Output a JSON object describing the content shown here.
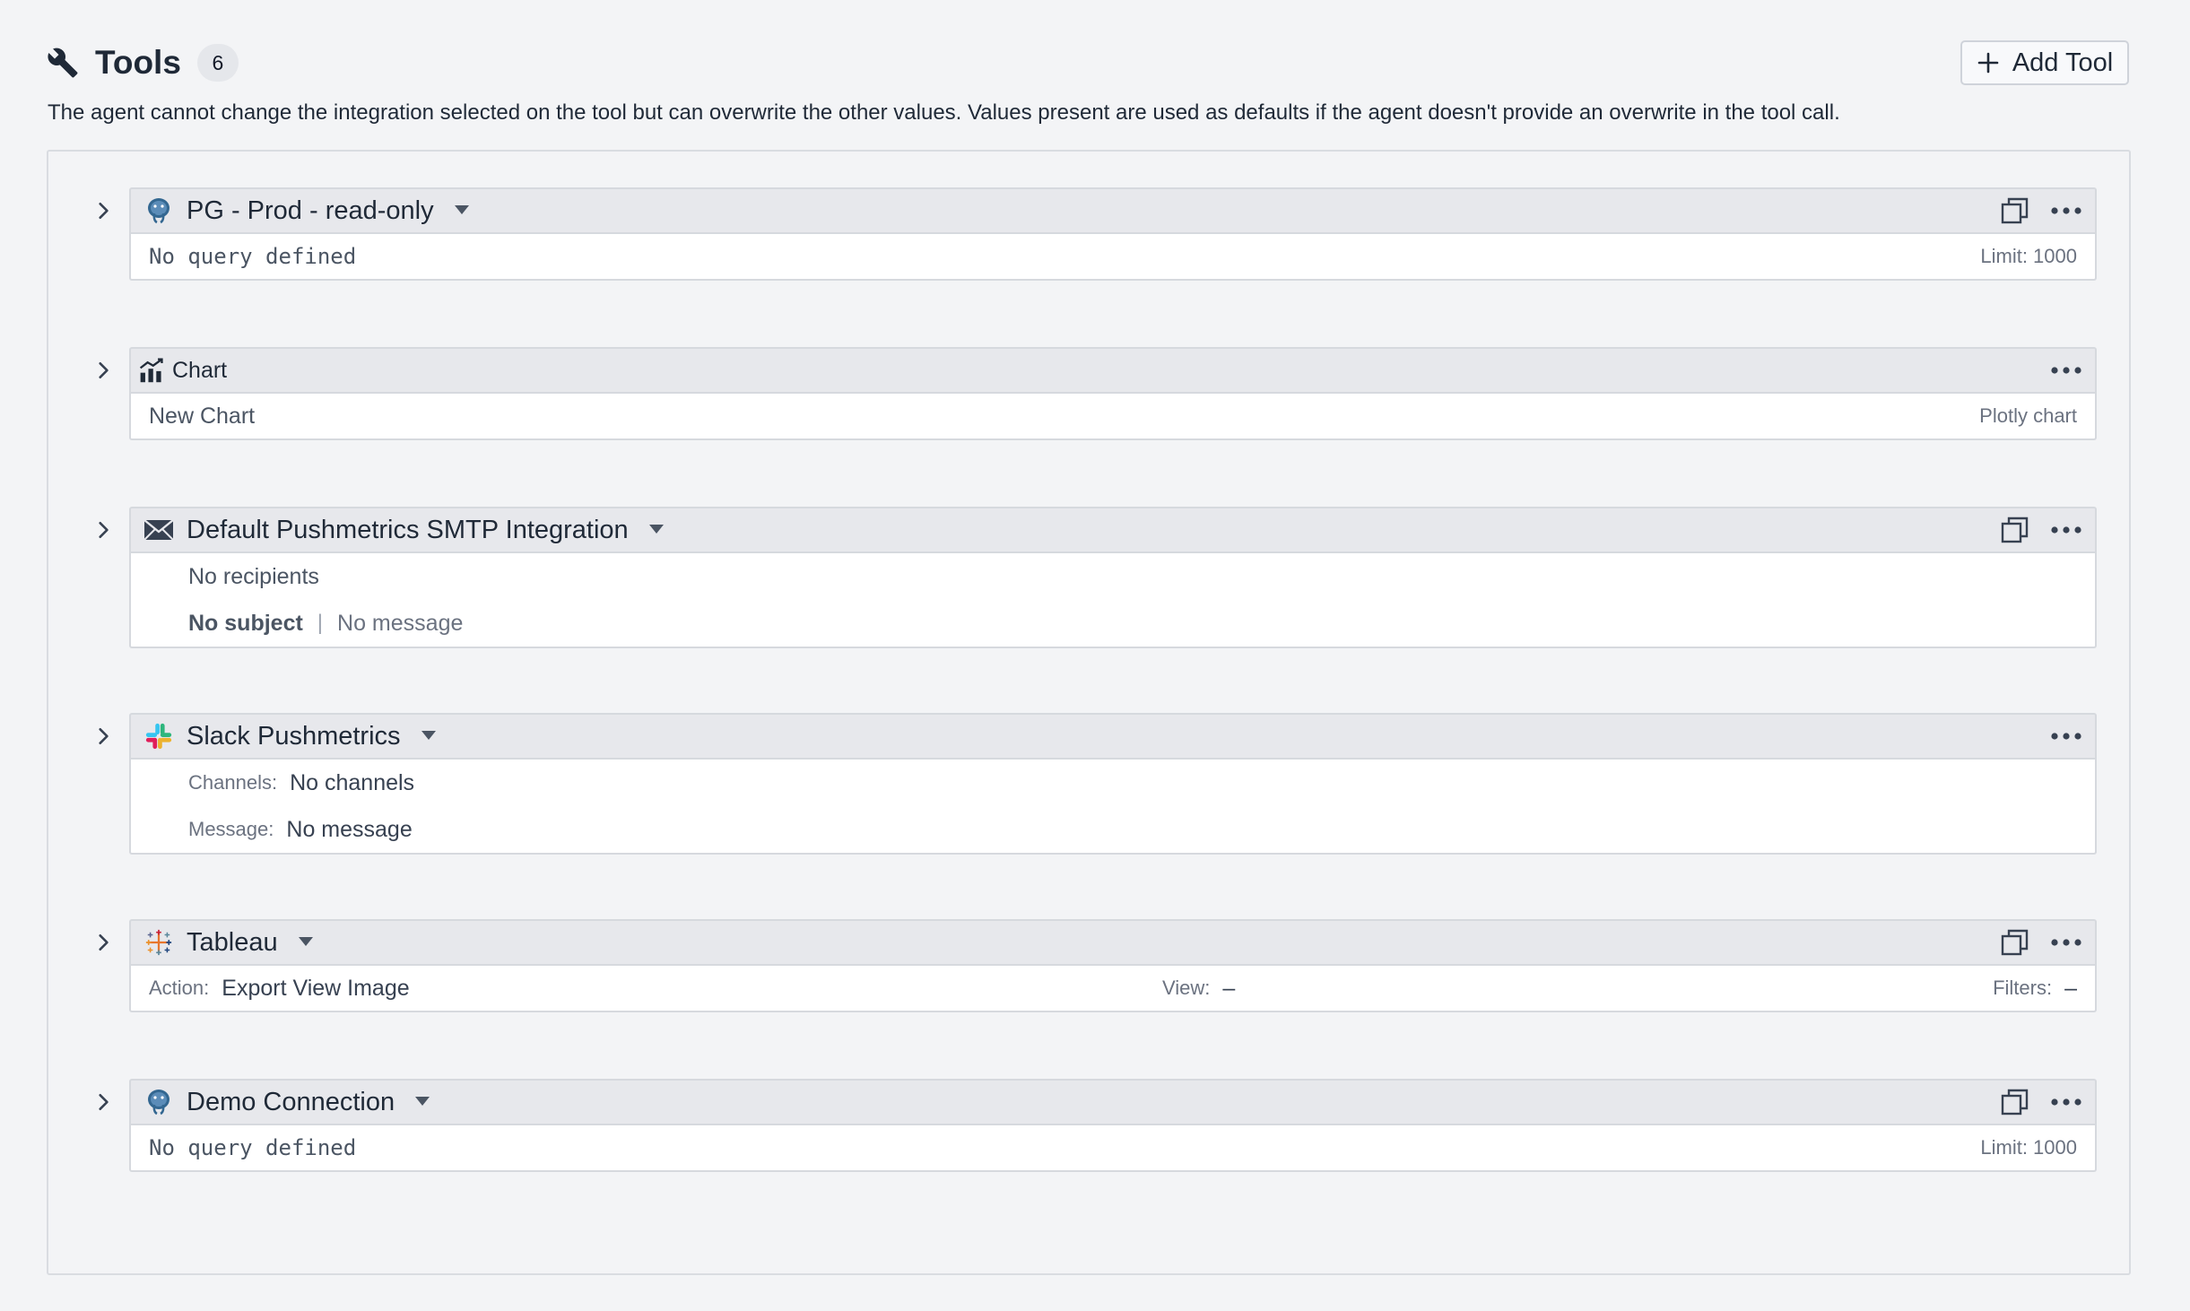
{
  "header": {
    "title": "Tools",
    "count": "6",
    "add_button_label": "Add Tool",
    "description": "The agent cannot change the integration selected on the tool but can overwrite the other values. Values present are used as defaults if the agent doesn't provide an overwrite in the tool call."
  },
  "tools": [
    {
      "name": "PG - Prod - read-only",
      "icon": "postgres-icon",
      "query": "No query defined",
      "limit": "Limit: 1000"
    },
    {
      "name": "Chart",
      "icon": "chart-icon",
      "chart_name": "New Chart",
      "chart_type": "Plotly chart"
    },
    {
      "name": "Default Pushmetrics SMTP Integration",
      "icon": "mail-icon",
      "recipients": "No recipients",
      "subject": "No subject",
      "separator": "|",
      "message": "No message"
    },
    {
      "name": "Slack Pushmetrics",
      "icon": "slack-icon",
      "channels_label": "Channels:",
      "channels_value": "No channels",
      "message_label": "Message:",
      "message_value": "No message"
    },
    {
      "name": "Tableau",
      "icon": "tableau-icon",
      "action_label": "Action:",
      "action_value": "Export View Image",
      "view_label": "View:",
      "view_value": "–",
      "filters_label": "Filters:",
      "filters_value": "–"
    },
    {
      "name": "Demo Connection",
      "icon": "postgres-icon",
      "query": "No query defined",
      "limit": "Limit: 1000"
    }
  ],
  "colors": {
    "background": "#f3f4f6",
    "header_bar": "#e7e8ec",
    "border": "#d6d9de",
    "text": "#1f2937",
    "muted": "#6b7280"
  }
}
